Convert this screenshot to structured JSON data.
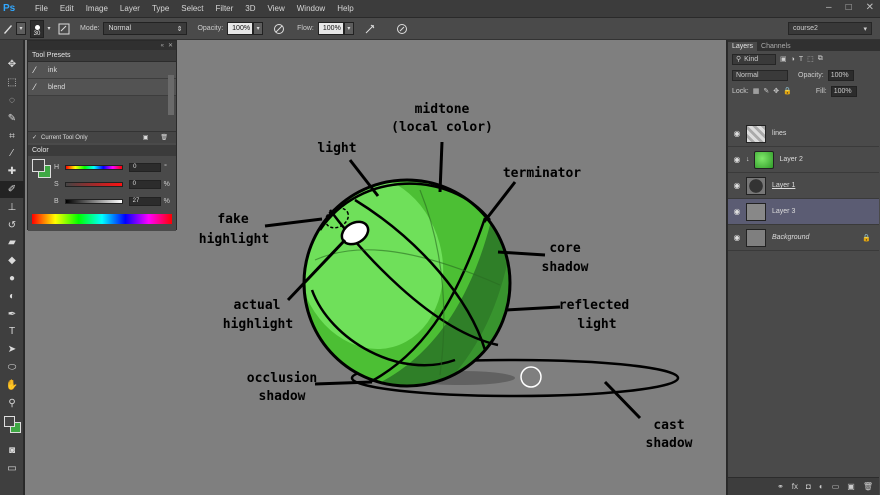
{
  "app": {
    "logo": "Ps"
  },
  "menu": [
    "File",
    "Edit",
    "Image",
    "Layer",
    "Type",
    "Select",
    "Filter",
    "3D",
    "View",
    "Window",
    "Help"
  ],
  "window_controls": [
    "–",
    "□",
    "✕"
  ],
  "options_bar": {
    "brush_size": "30",
    "mode_label": "Mode:",
    "mode_value": "Normal",
    "opacity_label": "Opacity:",
    "opacity_value": "100%",
    "flow_label": "Flow:",
    "flow_value": "100%",
    "workspace": "course2"
  },
  "tool_presets": {
    "tab": "Tool Presets",
    "items": [
      "ink",
      "blend"
    ],
    "current_tool_only": "Current Tool Only"
  },
  "color_panel": {
    "tab": "Color",
    "h_label": "H",
    "h_value": "0",
    "h_unit": "°",
    "s_label": "S",
    "s_value": "0",
    "s_unit": "%",
    "b_label": "B",
    "b_value": "27",
    "b_unit": "%"
  },
  "layers_panel": {
    "tabs": [
      "Layers",
      "Channels"
    ],
    "filter_kind": "Kind",
    "blend_mode": "Normal",
    "opacity_label": "Opacity:",
    "opacity_value": "100%",
    "lock_label": "Lock:",
    "fill_label": "Fill:",
    "fill_value": "100%",
    "layers": [
      "lines",
      "Layer 2",
      "Layer 1",
      "Layer 3",
      "Background"
    ]
  },
  "annotations": {
    "midtone": "midtone",
    "local_color": "(local color)",
    "light": "light",
    "terminator": "terminator",
    "fake": "fake",
    "highlight": "highlight",
    "core": "core",
    "shadow": "shadow",
    "actual": "actual",
    "actual_highlight": "highlight",
    "reflected": "reflected",
    "light2": "light",
    "occlusion": "occlusion",
    "occlusion_shadow": "shadow",
    "cast": "cast",
    "cast_shadow": "shadow"
  },
  "colors": {
    "sphere_light": "#6fe05a",
    "sphere_mid": "#4cbf34",
    "sphere_dark": "#2f7f28",
    "canvas_bg": "#7f7f7f"
  }
}
